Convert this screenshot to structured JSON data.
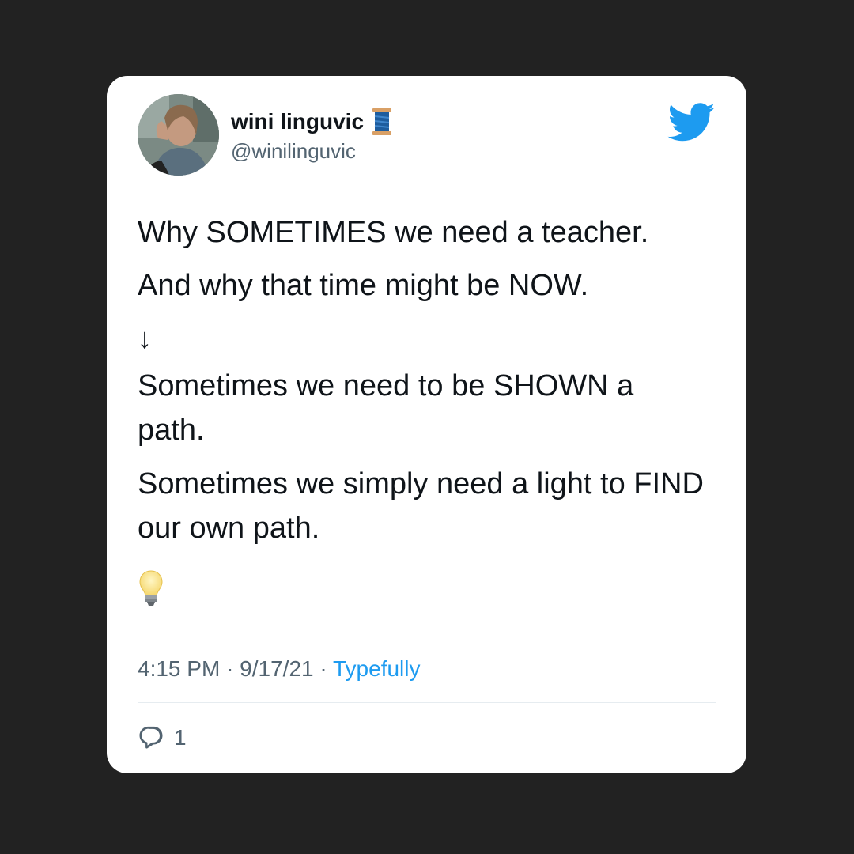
{
  "tweet": {
    "author": {
      "display_name": "wini linguvic",
      "handle": "@winilinguvic",
      "name_emoji_icon": "spool-of-thread-icon",
      "avatar": "profile-photo"
    },
    "lines": [
      "Why SOMETIMES we need a teacher.",
      "And why that time might be NOW.",
      "↓",
      "Sometimes we need to be SHOWN a path.",
      "Sometimes we simply need a light to FIND our own path."
    ],
    "trailing_emoji_icon": "light-bulb-icon",
    "time": "4:15 PM",
    "date": "9/17/21",
    "separator": "·",
    "source": "Typefully",
    "reply_count": "1"
  },
  "brand": {
    "logo_icon": "twitter-bird-icon",
    "accent_color": "#1d9bf0"
  },
  "colors": {
    "background": "#222222",
    "card": "#ffffff",
    "text_primary": "#0f1419",
    "text_secondary": "#536471"
  }
}
